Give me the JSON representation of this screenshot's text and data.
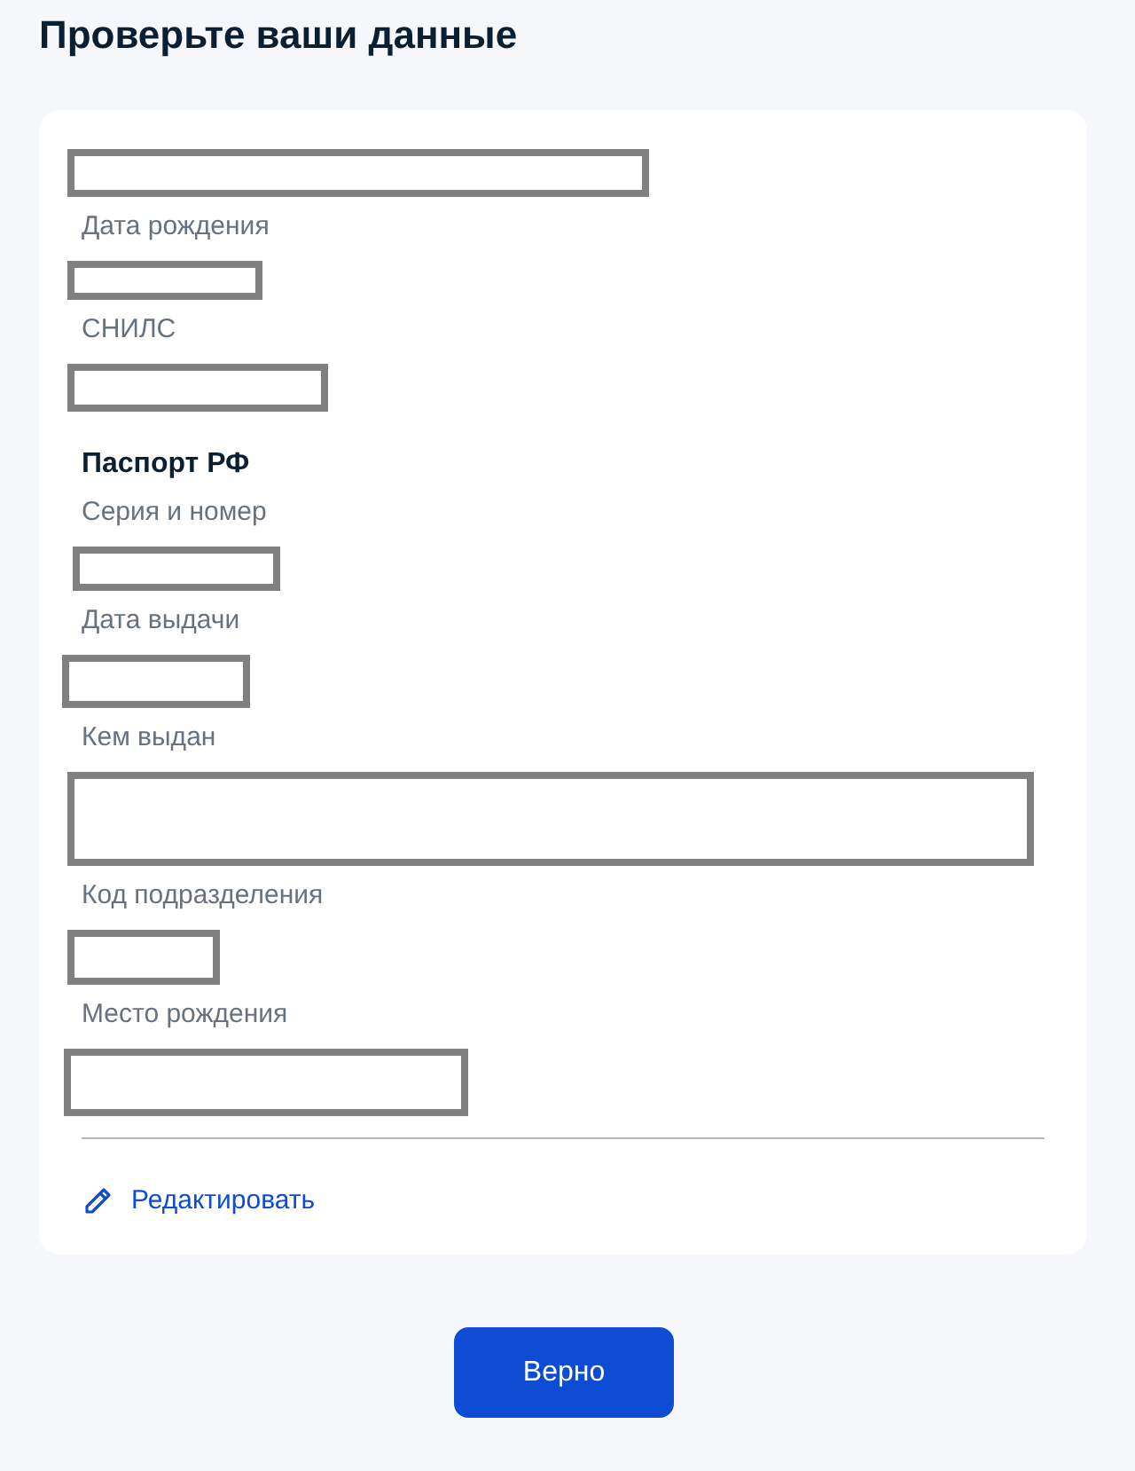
{
  "title": "Проверьте ваши данные",
  "card": {
    "holder": {
      "redacted": true
    },
    "fields": [
      {
        "label": "Дата рождения",
        "redacted": true
      },
      {
        "label": "СНИЛС",
        "redacted": true
      }
    ],
    "passport": {
      "heading": "Паспорт РФ",
      "fields": [
        {
          "label": "Серия и номер",
          "redacted": true
        },
        {
          "label": "Дата выдачи",
          "redacted": true
        },
        {
          "label": "Кем выдан",
          "redacted": true
        },
        {
          "label": "Код подразделения",
          "redacted": true
        },
        {
          "label": "Место рождения",
          "redacted": true
        }
      ]
    },
    "edit_link": "Редактировать"
  },
  "confirm_button": "Верно"
}
